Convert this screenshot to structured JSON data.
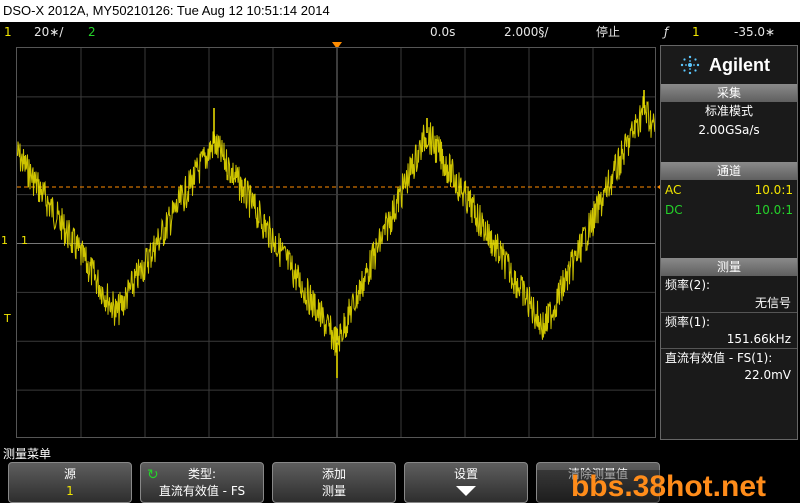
{
  "window": {
    "title": "DSO-X 2012A, MY50210126: Tue Aug 12 10:51:14 2014"
  },
  "status": {
    "ch1_num": "1",
    "ch1_scale": "20∗/",
    "ch2_num": "2",
    "time_delay": "0.0s",
    "time_base": "2.000§/",
    "run_state": "停止",
    "trig_icon": "ƒ",
    "trig_ch": "1",
    "trig_level": "-35.0∗"
  },
  "screen": {
    "ch1_marker": "1",
    "ch1_label": "1",
    "trigger_marker": "T",
    "trace_color": "#f2e600",
    "trigger_color": "#ff8c00"
  },
  "panel": {
    "brand": "Agilent",
    "acquire": {
      "title": "采集",
      "mode": "标准模式",
      "rate": "2.00GSa/s"
    },
    "channels": {
      "title": "通道",
      "rows": [
        {
          "coupling": "AC",
          "probe": "10.0:1"
        },
        {
          "coupling": "DC",
          "probe": "10.0:1"
        }
      ]
    },
    "measure": {
      "title": "测量",
      "items": [
        {
          "label": "频率(2):",
          "value": "无信号"
        },
        {
          "label": "频率(1):",
          "value": "151.66kHz"
        },
        {
          "label": "直流有效值 - FS(1):",
          "value": "22.0mV"
        }
      ]
    }
  },
  "softkeys": {
    "menu_title": "测量菜单",
    "source": {
      "label": "源",
      "value": "1"
    },
    "type": {
      "label": "类型:",
      "value": "直流有效值 - FS"
    },
    "add": {
      "label": "添加",
      "value": "测量"
    },
    "settings": {
      "label": "设置"
    },
    "clear": {
      "label": "清除测量值"
    }
  },
  "watermark": "bbs.38hot.net"
}
